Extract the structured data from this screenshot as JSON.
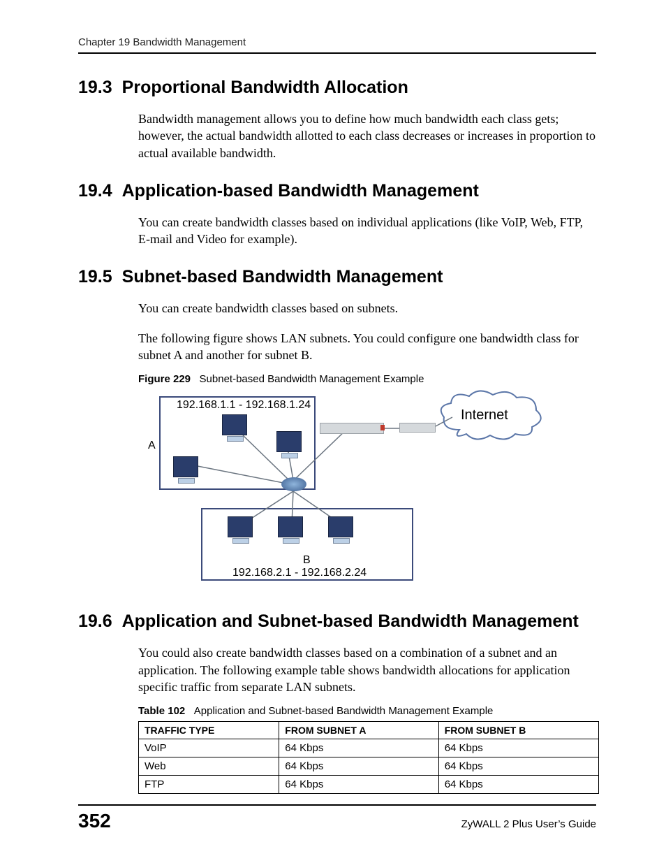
{
  "header": {
    "running_head": "Chapter 19 Bandwidth Management"
  },
  "sections": {
    "s1": {
      "num": "19.3",
      "title": "Proportional Bandwidth Allocation",
      "p1": "Bandwidth management allows you to define how much bandwidth each class gets; however, the actual bandwidth allotted to each class decreases or increases in proportion to actual available bandwidth."
    },
    "s2": {
      "num": "19.4",
      "title": "Application-based Bandwidth Management",
      "p1": "You can create bandwidth classes based on individual applications (like VoIP, Web, FTP, E-mail and Video for example)."
    },
    "s3": {
      "num": "19.5",
      "title": "Subnet-based Bandwidth Management",
      "p1": "You can create bandwidth classes based on subnets.",
      "p2": "The following figure shows LAN subnets. You could configure one bandwidth class for subnet A and another for subnet B."
    },
    "s4": {
      "num": "19.6",
      "title": "Application and Subnet-based Bandwidth Management",
      "p1": "You could also create bandwidth classes based on a combination of a subnet and an application. The following example table shows bandwidth allocations for application specific traffic from separate LAN subnets."
    }
  },
  "figure": {
    "label": "Figure 229",
    "caption": "Subnet-based Bandwidth Management Example",
    "subnet_a_label": "A",
    "subnet_b_label": "B",
    "range_a": "192.168.1.1 - 192.168.1.24",
    "range_b": "192.168.2.1 - 192.168.2.24",
    "internet": "Internet"
  },
  "table": {
    "label": "Table 102",
    "caption": "Application and Subnet-based Bandwidth Management Example",
    "headers": {
      "c1": "TRAFFIC TYPE",
      "c2": "FROM SUBNET A",
      "c3": "FROM SUBNET B"
    },
    "rows": [
      {
        "c1": "VoIP",
        "c2": "64 Kbps",
        "c3": "64 Kbps"
      },
      {
        "c1": "Web",
        "c2": "64 Kbps",
        "c3": "64 Kbps"
      },
      {
        "c1": "FTP",
        "c2": "64 Kbps",
        "c3": "64 Kbps"
      }
    ]
  },
  "footer": {
    "page": "352",
    "guide": "ZyWALL 2 Plus User’s Guide"
  }
}
